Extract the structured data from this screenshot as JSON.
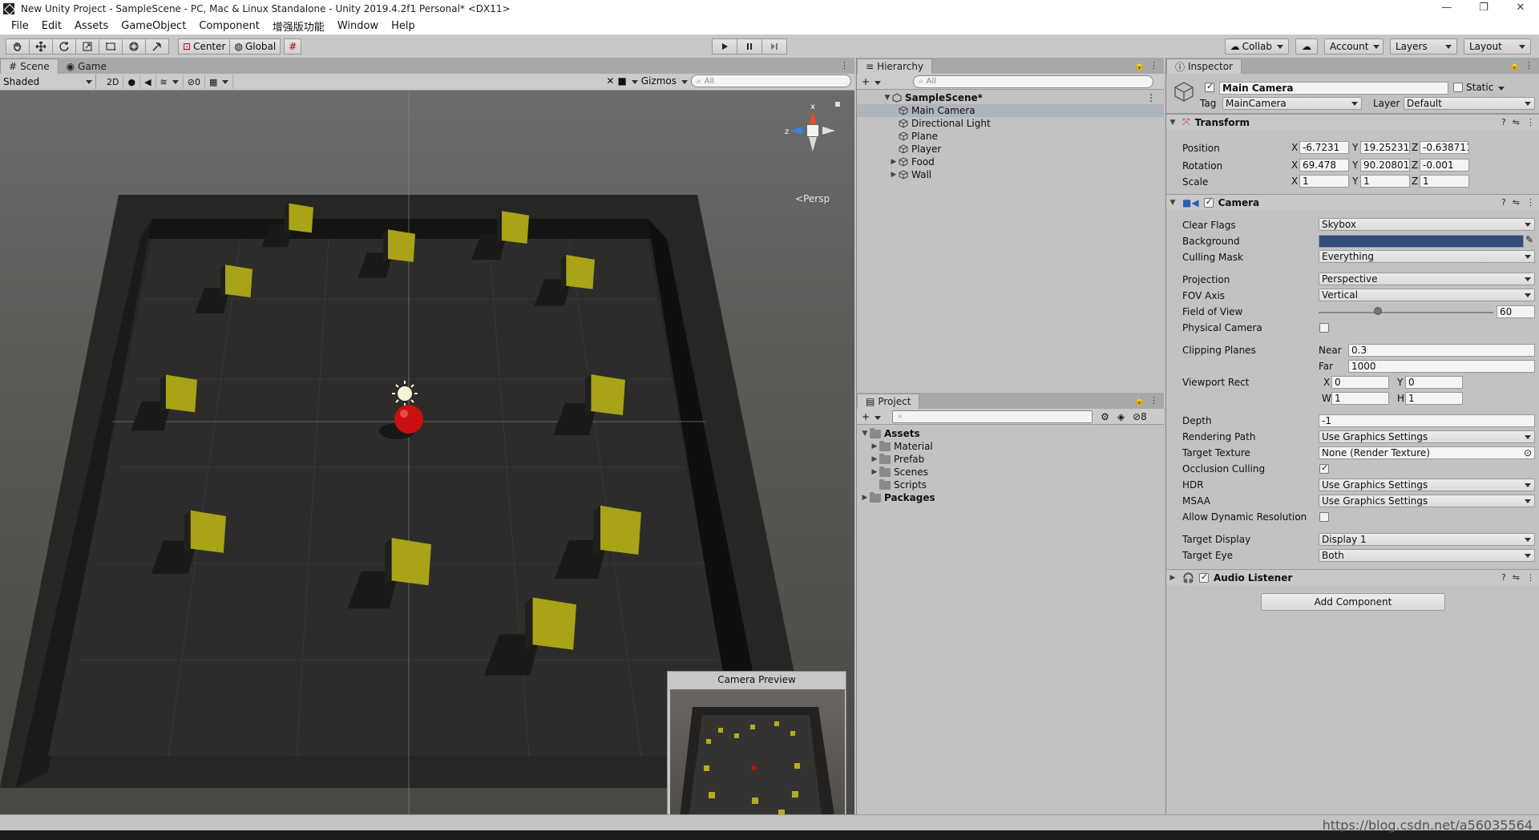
{
  "window": {
    "title": "New Unity Project - SampleScene - PC, Mac & Linux Standalone - Unity 2019.4.2f1 Personal* <DX11>",
    "controls": [
      "—",
      "❐",
      "✕"
    ]
  },
  "menu": [
    "File",
    "Edit",
    "Assets",
    "GameObject",
    "Component",
    "增强版功能",
    "Window",
    "Help"
  ],
  "toolbar": {
    "pivot": "Center",
    "space": "Global",
    "collab": "Collab",
    "account": "Account",
    "layers": "Layers",
    "layout": "Layout"
  },
  "scene": {
    "tabs": [
      "Scene",
      "Game"
    ],
    "shading": "Shaded",
    "mode_2d": "2D",
    "hidden_count": "0",
    "gizmos": "Gizmos",
    "search_placeholder": "All",
    "persp": "Persp",
    "gizmo_axes": {
      "x": "x",
      "z": "z"
    },
    "camera_preview_title": "Camera Preview"
  },
  "hierarchy": {
    "tab": "Hierarchy",
    "search_placeholder": "All",
    "scene_name": "SampleScene*",
    "items": [
      {
        "label": "Main Camera",
        "selected": true,
        "expandable": false
      },
      {
        "label": "Directional Light",
        "selected": false,
        "expandable": false
      },
      {
        "label": "Plane",
        "selected": false,
        "expandable": false
      },
      {
        "label": "Player",
        "selected": false,
        "expandable": false
      },
      {
        "label": "Food",
        "selected": false,
        "expandable": true
      },
      {
        "label": "Wall",
        "selected": false,
        "expandable": true
      }
    ]
  },
  "project": {
    "tab": "Project",
    "hidden_count": "8",
    "root": "Assets",
    "folders": [
      {
        "label": "Material",
        "expandable": true
      },
      {
        "label": "Prefab",
        "expandable": true
      },
      {
        "label": "Scenes",
        "expandable": true
      },
      {
        "label": "Scripts",
        "expandable": false
      }
    ],
    "packages": "Packages"
  },
  "inspector": {
    "tab": "Inspector",
    "object_name": "Main Camera",
    "static_label": "Static",
    "tag_label": "Tag",
    "tag": "MainCamera",
    "layer_label": "Layer",
    "layer": "Default",
    "transform": {
      "title": "Transform",
      "position_label": "Position",
      "rotation_label": "Rotation",
      "scale_label": "Scale",
      "position": {
        "x": "-6.7231",
        "y": "19.25231",
        "z": "-0.6387119"
      },
      "rotation": {
        "x": "69.478",
        "y": "90.20801",
        "z": "-0.001"
      },
      "scale": {
        "x": "1",
        "y": "1",
        "z": "1"
      }
    },
    "camera": {
      "title": "Camera",
      "clear_flags_label": "Clear Flags",
      "clear_flags": "Skybox",
      "background_label": "Background",
      "background_color": "#314D79",
      "culling_mask_label": "Culling Mask",
      "culling_mask": "Everything",
      "projection_label": "Projection",
      "projection": "Perspective",
      "fov_axis_label": "FOV Axis",
      "fov_axis": "Vertical",
      "fov_label": "Field of View",
      "fov": "60",
      "fov_slider_fraction": 0.34,
      "physical_label": "Physical Camera",
      "clipping_label": "Clipping Planes",
      "near_label": "Near",
      "near": "0.3",
      "far_label": "Far",
      "far": "1000",
      "viewport_label": "Viewport Rect",
      "vx": "0",
      "vy": "0",
      "vw": "1",
      "vh": "1",
      "depth_label": "Depth",
      "depth": "-1",
      "rendering_path_label": "Rendering Path",
      "rendering_path": "Use Graphics Settings",
      "target_texture_label": "Target Texture",
      "target_texture": "None (Render Texture)",
      "occlusion_label": "Occlusion Culling",
      "hdr_label": "HDR",
      "hdr": "Use Graphics Settings",
      "msaa_label": "MSAA",
      "msaa": "Use Graphics Settings",
      "dynres_label": "Allow Dynamic Resolution",
      "target_display_label": "Target Display",
      "target_display": "Display 1",
      "target_eye_label": "Target Eye",
      "target_eye": "Both"
    },
    "audio_listener": "Audio Listener",
    "add_component": "Add Component"
  },
  "watermark": "https://blog.csdn.net/a56035564",
  "colors": {
    "cube": "#A8A317",
    "player": "#D01010",
    "floor": "#2B2A29",
    "wall": "#1B1B1A"
  }
}
